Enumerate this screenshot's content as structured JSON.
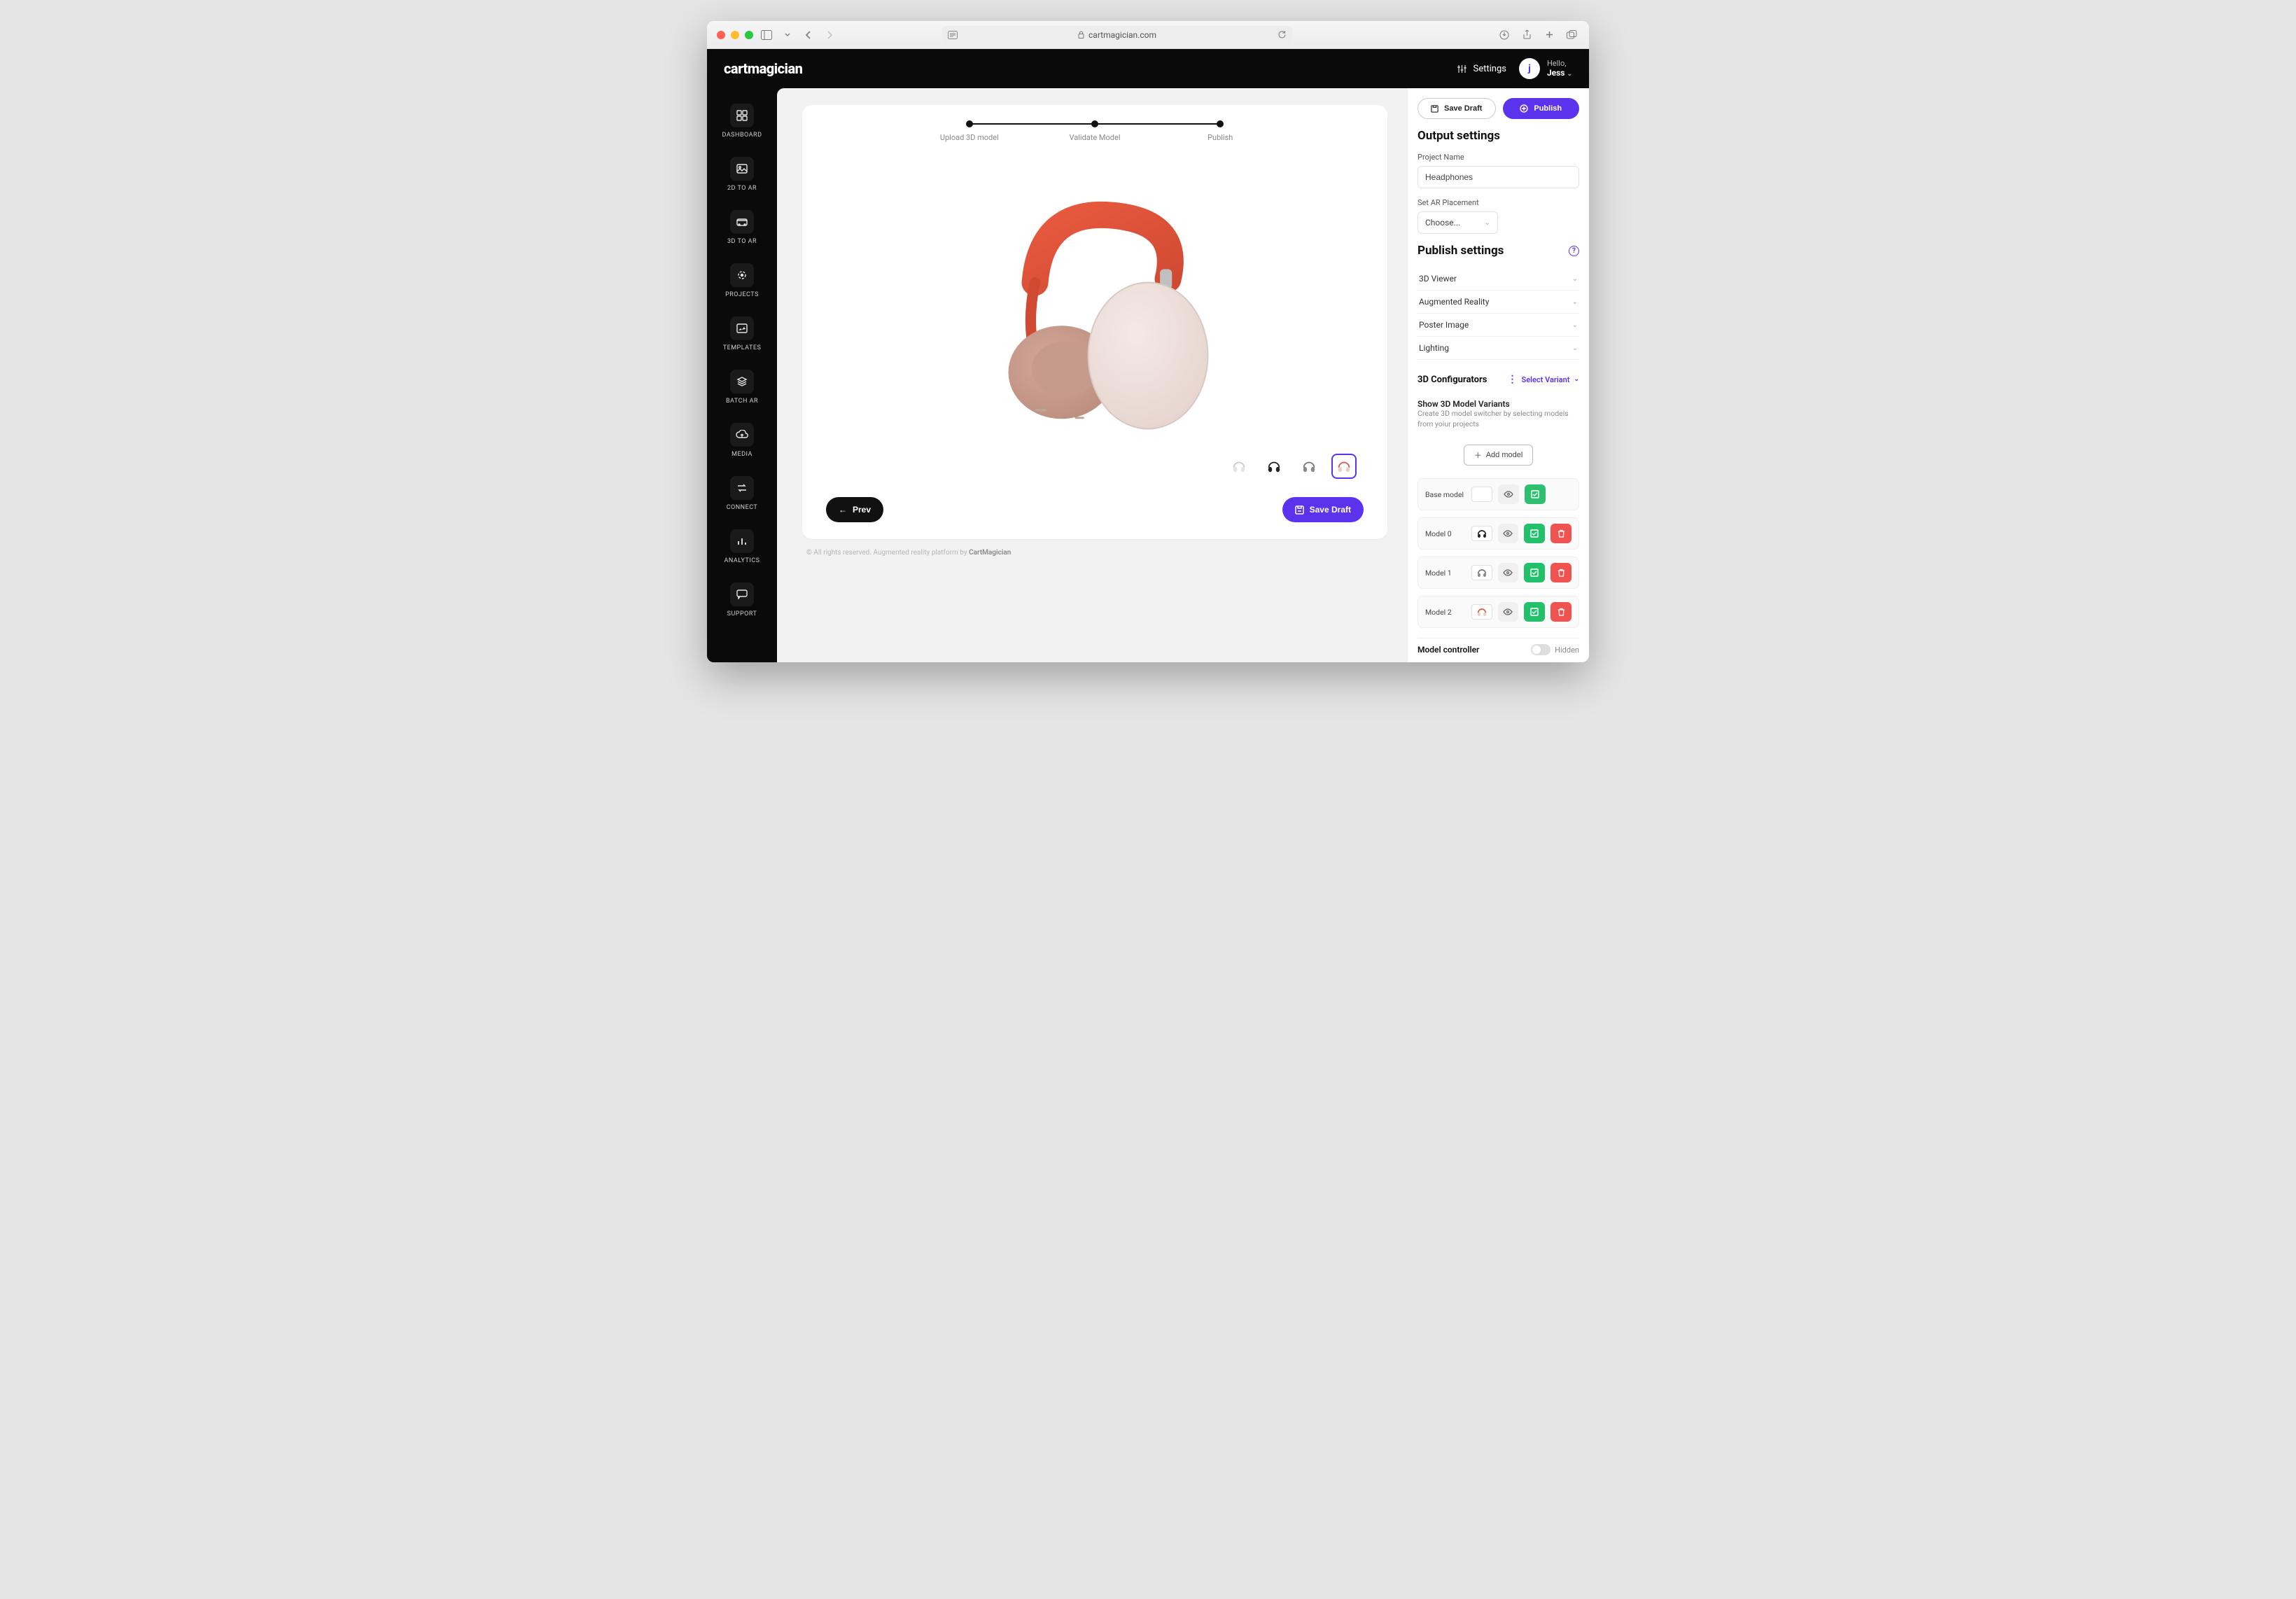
{
  "browser": {
    "url_host": "cartmagician.com"
  },
  "topbar": {
    "brand": "cartmagician",
    "settings_label": "Settings",
    "user_greeting": "Hello,",
    "user_name": "Jess",
    "avatar_initial": "j"
  },
  "sidebar": {
    "items": [
      {
        "label": "DASHBOARD",
        "icon": "dashboard-icon"
      },
      {
        "label": "2D TO AR",
        "icon": "image-icon"
      },
      {
        "label": "3D TO AR",
        "icon": "cube-icon"
      },
      {
        "label": "PROJECTS",
        "icon": "target-icon"
      },
      {
        "label": "TEMPLATES",
        "icon": "templates-icon"
      },
      {
        "label": "BATCH AR",
        "icon": "layers-icon"
      },
      {
        "label": "MEDIA",
        "icon": "cloud-icon"
      },
      {
        "label": "CONNECT",
        "icon": "swap-icon"
      },
      {
        "label": "ANALYTICS",
        "icon": "bars-icon"
      },
      {
        "label": "SUPPORT",
        "icon": "chat-icon"
      }
    ]
  },
  "stepper": {
    "steps": [
      "Upload 3D model",
      "Validate Model",
      "Publish"
    ]
  },
  "thumbnails": {
    "items": [
      {
        "variant": "silver",
        "active": false
      },
      {
        "variant": "black",
        "active": false
      },
      {
        "variant": "grey",
        "active": false
      },
      {
        "variant": "coral",
        "active": true
      }
    ]
  },
  "canvas_buttons": {
    "prev": "Prev",
    "save_draft": "Save Draft"
  },
  "footer": {
    "prefix": "© All rights reserved. Augmented reality platform by ",
    "brand": "CartMagician"
  },
  "panel": {
    "save_draft": "Save Draft",
    "publish": "Publish",
    "output_heading": "Output settings",
    "project_name_label": "Project Name",
    "project_name_value": "Headphones",
    "ar_placement_label": "Set AR Placement",
    "ar_placement_value": "Choose...",
    "publish_heading": "Publish settings",
    "accordion": [
      "3D Viewer",
      "Augmented Reality",
      "Poster Image",
      "Lighting"
    ],
    "configurators_heading": "3D Configurators",
    "select_variant": "Select Variant",
    "variants_heading": "Show 3D Model Variants",
    "variants_desc": "Create 3D model switcher by selecting models from yoiur projects",
    "add_model": "Add model",
    "models": [
      {
        "name": "Base model",
        "thumb": "none"
      },
      {
        "name": "Model 0",
        "thumb": "black"
      },
      {
        "name": "Model 1",
        "thumb": "grey"
      },
      {
        "name": "Model 2",
        "thumb": "coral"
      }
    ],
    "controller_label": "Model controller",
    "controller_state": "Hidden"
  }
}
